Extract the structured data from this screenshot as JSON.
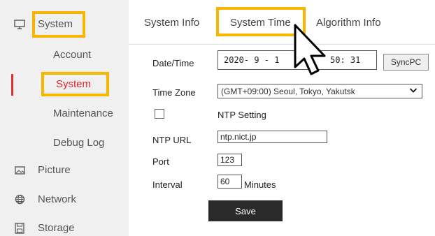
{
  "sidebar": {
    "system": {
      "label": "System",
      "icon": "monitor-icon"
    },
    "sub_items": [
      {
        "label": "Account"
      },
      {
        "label": "System"
      },
      {
        "label": "Maintenance"
      },
      {
        "label": "Debug Log"
      }
    ],
    "picture": {
      "label": "Picture",
      "icon": "image-icon"
    },
    "network": {
      "label": "Network",
      "icon": "globe-icon"
    },
    "storage": {
      "label": "Storage",
      "icon": "save-icon"
    }
  },
  "tabs": [
    {
      "label": "System Info"
    },
    {
      "label": "System Time"
    },
    {
      "label": "Algorithm Info"
    }
  ],
  "form": {
    "datetime_label": "Date/Time",
    "date_value": "2020- 9 - 1",
    "time_value": "50: 31",
    "sync_label": "SyncPC",
    "timezone_label": "Time Zone",
    "timezone_value": "(GMT+09:00) Seoul, Tokyo, Yakutsk",
    "ntp_setting_label": "NTP Setting",
    "ntp_checked": false,
    "ntp_url_label": "NTP URL",
    "ntp_url_value": "ntp.nict.jp",
    "port_label": "Port",
    "port_value": "123",
    "interval_label": "Interval",
    "interval_value": "60",
    "interval_unit": "Minutes",
    "save_label": "Save"
  },
  "colors": {
    "highlight": "#f7b500",
    "active": "#e0222a",
    "sidebar_bg": "#f0f0f0",
    "save_bg": "#2a2a2a"
  }
}
